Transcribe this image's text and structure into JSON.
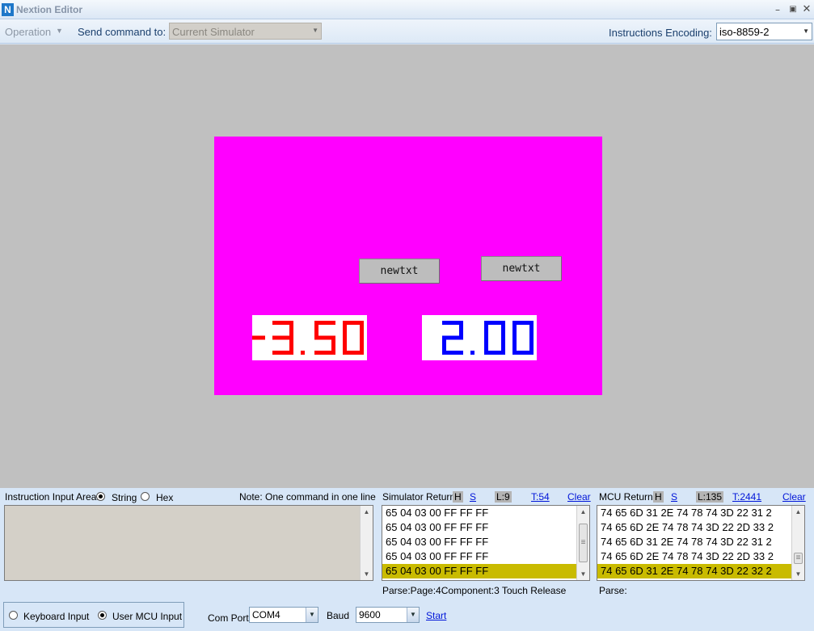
{
  "window": {
    "title": "Nextion Editor",
    "logo_letter": "N",
    "minimize_glyph": "–",
    "maximize_glyph": "▣",
    "close_glyph": "✕"
  },
  "toolbar": {
    "operation_label": "Operation",
    "send_label": "Send command to:",
    "send_target": "Current Simulator",
    "encoding_label": "Instructions Encoding:",
    "encoding_value": "iso-8859-2"
  },
  "screen": {
    "background": "#ff00ff",
    "button1_label": "newtxt",
    "button2_label": "newtxt",
    "number1": {
      "value": "-3.50",
      "color": "#ff0000"
    },
    "number2": {
      "value": "2.00",
      "color": "#0000ff"
    }
  },
  "input_area": {
    "label": "Instruction Input Area:",
    "string_label": "String",
    "hex_label": "Hex",
    "selected": "String",
    "note": "Note: One command in one line"
  },
  "simulator_return": {
    "label": "Simulator Return:",
    "h_label": "H",
    "s_label": "S",
    "line_count": "L:9",
    "total_count": "T:54",
    "clear_label": "Clear",
    "rows": [
      "65 04 03 00 FF FF FF",
      "65 04 03 00 FF FF FF",
      "65 04 03 00 FF FF FF",
      "65 04 03 00 FF FF FF",
      "65 04 03 00 FF FF FF"
    ],
    "selected_index": 4,
    "parse_text": "Parse:Page:4Component:3 Touch Release"
  },
  "mcu_return": {
    "label": "MCU Return:",
    "h_label": "H",
    "s_label": "S",
    "line_count": "L:135",
    "total_count": "T:2441",
    "clear_label": "Clear",
    "rows": [
      "74 65 6D 31 2E 74 78 74 3D 22 31 2",
      "74 65 6D 2E 74 78 74 3D 22 2D 33 2",
      "74 65 6D 31 2E 74 78 74 3D 22 31 2",
      "74 65 6D 2E 74 78 74 3D 22 2D 33 2",
      "74 65 6D 31 2E 74 78 74 3D 22 32 2"
    ],
    "selected_index": 4,
    "parse_text": "Parse:"
  },
  "input_mode": {
    "keyboard_label": "Keyboard Input",
    "mcu_label": "User MCU Input",
    "selected": "User MCU Input"
  },
  "connection": {
    "com_port_label": "Com Port",
    "com_port_value": "COM4",
    "baud_label": "Baud",
    "baud_value": "9600",
    "start_label": "Start"
  }
}
